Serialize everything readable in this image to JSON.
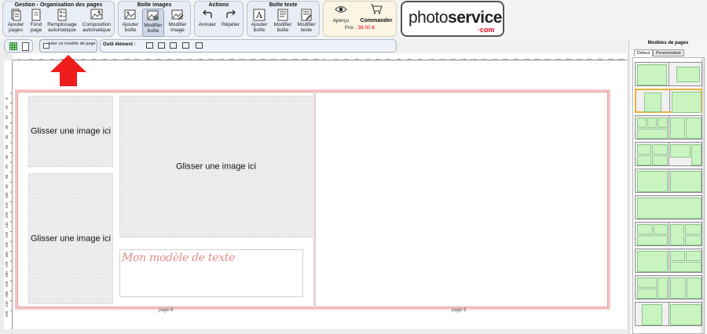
{
  "toolbar": {
    "gestion": {
      "title": "Gestion - Organisation des pages",
      "buttons": [
        {
          "label": "Ajouter pages",
          "icon": "add-pages-icon"
        },
        {
          "label": "Fond page",
          "icon": "page-background-icon"
        },
        {
          "label": "Remplissage automatique",
          "icon": "auto-fill-icon"
        },
        {
          "label": "Composition automatique",
          "icon": "auto-compose-icon"
        }
      ]
    },
    "boite_images": {
      "title": "Boîte images",
      "buttons": [
        {
          "label": "Ajouter boîte",
          "icon": "add-image-box-icon"
        },
        {
          "label": "Modifier boîte",
          "icon": "edit-image-box-icon",
          "active": true
        },
        {
          "label": "Modifier image",
          "icon": "edit-image-icon"
        }
      ]
    },
    "actions": {
      "title": "Actions",
      "buttons": [
        {
          "label": "Annuler",
          "icon": "undo-icon"
        },
        {
          "label": "Répéter",
          "icon": "redo-icon"
        }
      ]
    },
    "boite_texte": {
      "title": "Boîte texte",
      "buttons": [
        {
          "label": "Ajouter boîte",
          "icon": "add-text-box-icon"
        },
        {
          "label": "Modifier boîte",
          "icon": "edit-text-box-icon"
        },
        {
          "label": "Modifier texte",
          "icon": "edit-text-icon"
        }
      ]
    },
    "preview": {
      "apercu": "Aperçu",
      "commander": "Commander",
      "prix_label": "Prix :",
      "prix_value": "38.00 €"
    },
    "logo": {
      "text_light": "photo",
      "text_bold": "service",
      "suffix": "·com"
    }
  },
  "toolbar2": {
    "create_model": "créer un modèle de page",
    "tool_label": "Outil élément :",
    "tool_icons": [
      "tool-frame-icon-1",
      "tool-frame-icon-2",
      "tool-frame-icon-3",
      "tool-frame-icon-4",
      "tool-frame-icon-5"
    ]
  },
  "ruler": {
    "numbers": [
      "0",
      "10",
      "20",
      "30",
      "40",
      "50",
      "60",
      "70",
      "80",
      "90",
      "100",
      "110",
      "120",
      "130",
      "140",
      "150",
      "160",
      "170",
      "180",
      "190",
      "200",
      "210",
      "220",
      "230",
      "240",
      "250",
      "260",
      "270",
      "280",
      "0",
      "10",
      "20",
      "30",
      "40",
      "50",
      "60",
      "70",
      "80",
      "90",
      "100",
      "110",
      "120",
      "130",
      "140",
      "150",
      "160",
      "170",
      "180",
      "190",
      "200",
      "210",
      "220",
      "230",
      "240",
      "250",
      "260",
      "270",
      "280"
    ],
    "v_numbers": [
      "0",
      "10",
      "20",
      "30",
      "40",
      "50",
      "60",
      "70",
      "80",
      "90",
      "100",
      "110",
      "120",
      "130",
      "140",
      "150",
      "160",
      "170",
      "180",
      "190",
      "200",
      "210",
      "220"
    ]
  },
  "canvas": {
    "placeholder": "Glisser une image ici",
    "text_model": "Mon modèle de texte",
    "page_left": "page 8",
    "page_right": "page 9"
  },
  "right_panel": {
    "title": "Modèles de pages",
    "tabs": [
      "Défaut",
      "Personnalisé"
    ],
    "active_tab": 0,
    "active_template": 1
  }
}
